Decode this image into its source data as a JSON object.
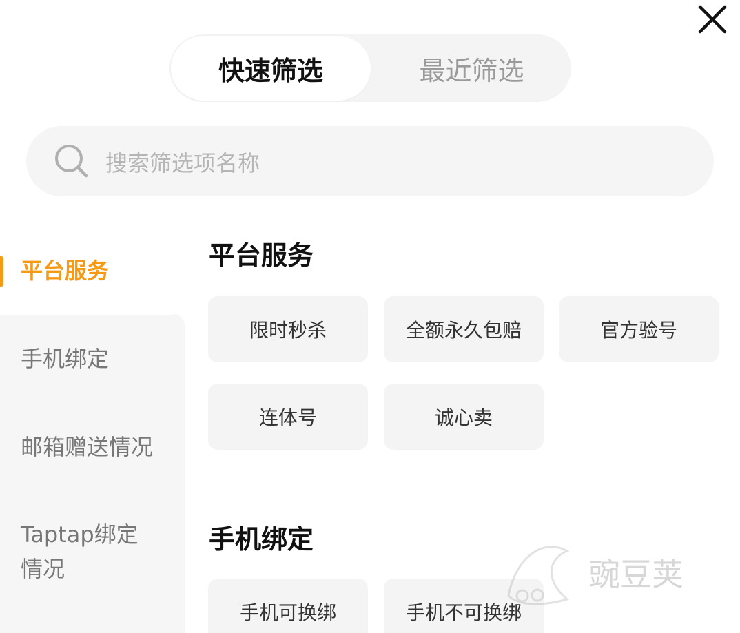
{
  "tabs": {
    "quick": "快速筛选",
    "recent": "最近筛选"
  },
  "search": {
    "placeholder": "搜索筛选项名称"
  },
  "sidebar": {
    "items": [
      {
        "label": "平台服务"
      },
      {
        "label": "手机绑定"
      },
      {
        "label": "邮箱赠送情况"
      },
      {
        "label": "Taptap绑定",
        "label2": "情况"
      }
    ]
  },
  "sections": [
    {
      "title": "平台服务",
      "options": [
        "限时秒杀",
        "全额永久包赔",
        "官方验号",
        "连体号",
        "诚心卖"
      ]
    },
    {
      "title": "手机绑定",
      "options": [
        "手机可换绑",
        "手机不可换绑"
      ]
    }
  ],
  "watermark": {
    "text": "豌豆荚"
  },
  "colors": {
    "accent": "#f49a14",
    "chip_bg": "#f4f4f4",
    "placeholder": "#b5b5b5"
  },
  "icons": {
    "close": "close-icon",
    "search": "search-icon"
  }
}
